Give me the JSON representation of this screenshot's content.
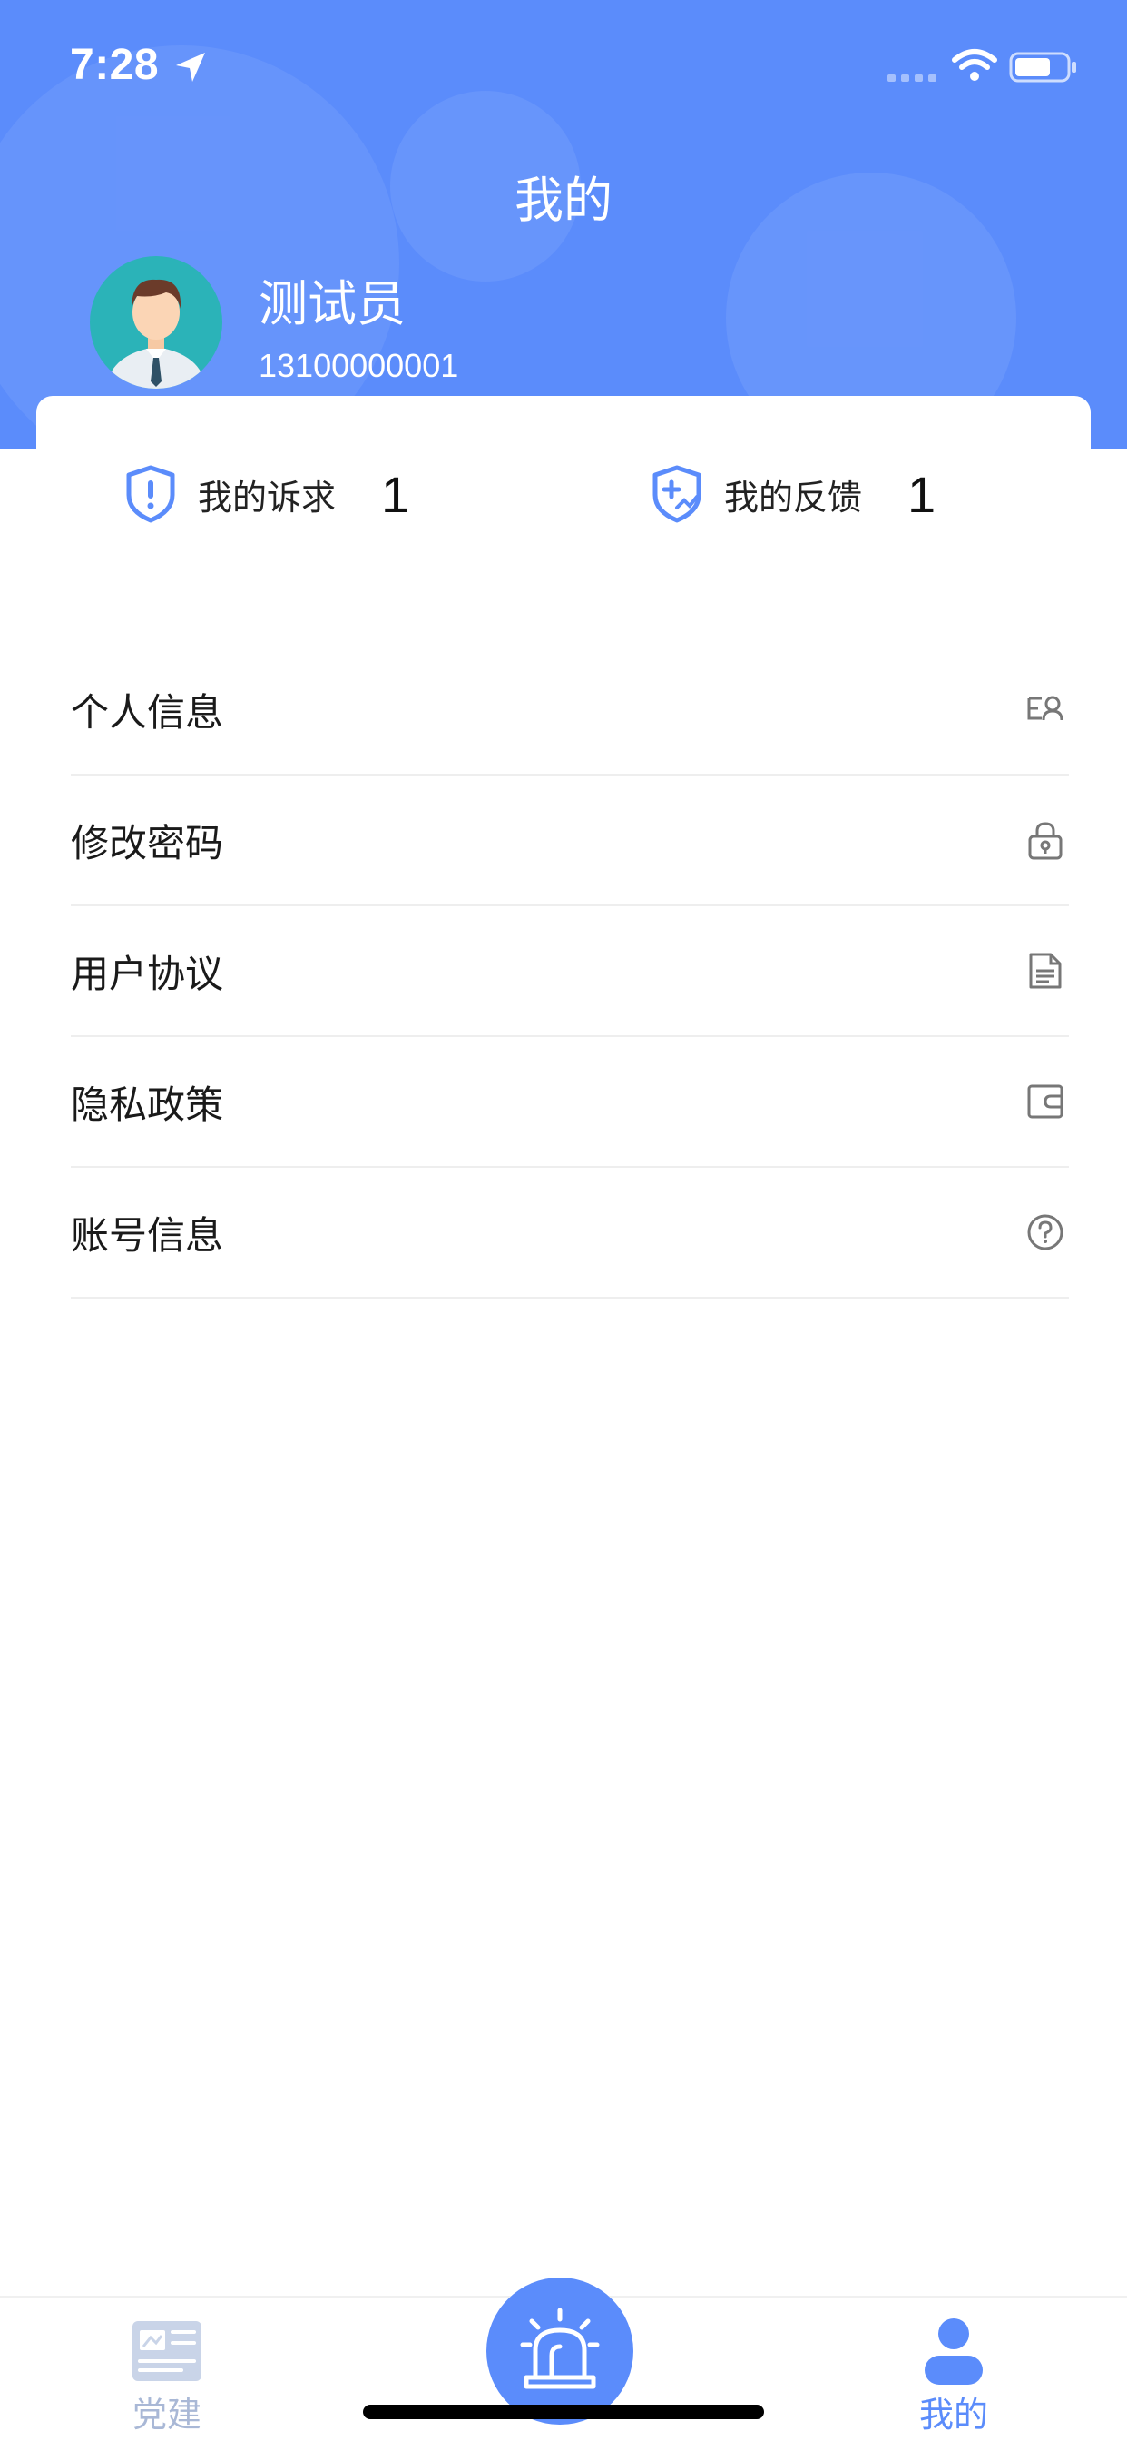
{
  "status_bar": {
    "time": "7:28"
  },
  "header": {
    "title": "我的",
    "user": {
      "name": "测试员",
      "phone": "13100000001"
    }
  },
  "stats": [
    {
      "label": "我的诉求",
      "value": "1",
      "icon": "shield-alert-icon"
    },
    {
      "label": "我的反馈",
      "value": "1",
      "icon": "shield-plus-icon"
    }
  ],
  "menu": [
    {
      "label": "个人信息",
      "icon": "profile-card-icon"
    },
    {
      "label": "修改密码",
      "icon": "lock-icon"
    },
    {
      "label": "用户协议",
      "icon": "document-icon"
    },
    {
      "label": "隐私政策",
      "icon": "wallet-icon"
    },
    {
      "label": "账号信息",
      "icon": "question-circle-icon"
    }
  ],
  "tabbar": {
    "tabs": [
      {
        "label": "党建",
        "icon": "newspaper-icon",
        "active": false
      },
      {
        "label": "我的",
        "icon": "person-icon",
        "active": true
      }
    ],
    "center_icon": "alarm-icon"
  },
  "colors": {
    "primary": "#5b8cfb",
    "inactive_tab": "#a9b8d6"
  }
}
